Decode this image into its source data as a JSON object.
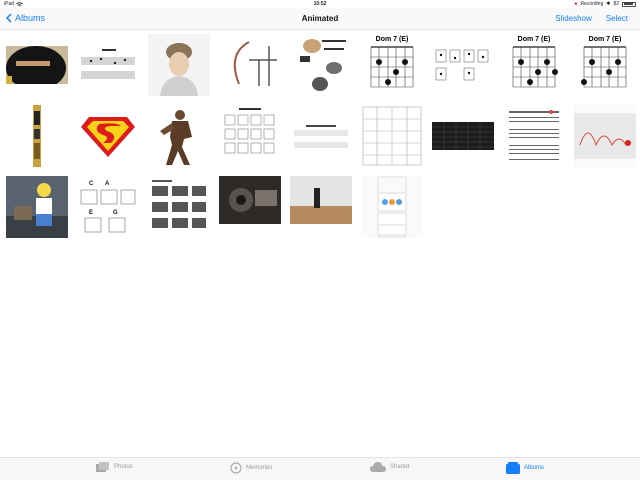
{
  "status_bar": {
    "device": "iPad",
    "time": "10:52",
    "recording": "Recording",
    "battery": "82",
    "battery_level": 0.82
  },
  "nav": {
    "back_label": "Albums",
    "title": "Animated",
    "slideshow_label": "Slideshow",
    "select_label": "Select"
  },
  "charts": {
    "chord1_title": "Dom 7 (E)",
    "chord2_title": "Dom 7 (E)",
    "chord3_title": "Dom 7 (E)",
    "chords_c": "C",
    "chords_a": "A",
    "chords_e": "E",
    "chords_g": "G"
  },
  "tabs": [
    {
      "label": "Photos",
      "icon": "photos-icon"
    },
    {
      "label": "Memories",
      "icon": "memories-icon"
    },
    {
      "label": "Shared",
      "icon": "cloud-icon"
    },
    {
      "label": "Albums",
      "icon": "albums-icon"
    }
  ],
  "colors": {
    "accent": "#147efb",
    "inactive": "#9a9a9a"
  }
}
